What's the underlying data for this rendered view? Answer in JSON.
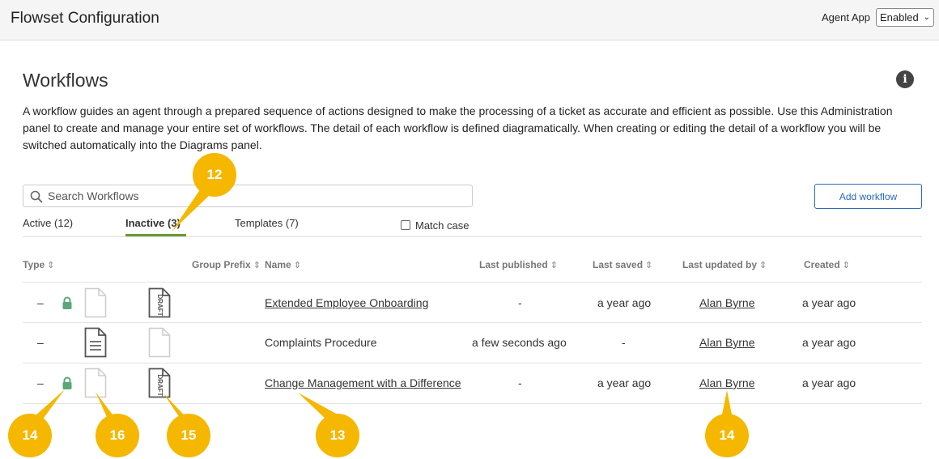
{
  "header": {
    "title": "Flowset Configuration",
    "agent_app_label": "Agent App",
    "agent_app_value": "Enabled"
  },
  "main": {
    "title": "Workflows",
    "description": "A workflow guides an agent through a prepared sequence of actions designed to make the processing of a ticket as accurate and efficient as possible. Use this Administration panel to create and manage your entire set of workflows. The detail of each workflow is defined diagramatically. When creating or editing the detail of a workflow you will be switched automatically into the Diagrams panel.",
    "search_placeholder": "Search Workflows",
    "add_button": "Add workflow",
    "tabs": [
      {
        "label": "Active (12)"
      },
      {
        "label": "Inactive (3)"
      },
      {
        "label": "Templates (7)"
      }
    ],
    "match_case_label": "Match case"
  },
  "table": {
    "columns": [
      "Type",
      "Group Prefix",
      "Name",
      "Last published",
      "Last saved",
      "Last updated by",
      "Created"
    ],
    "rows": [
      {
        "type": "–",
        "name": "Extended Employee Onboarding",
        "last_published": "-",
        "last_saved": "a year ago",
        "updated_by": "Alan Byrne",
        "created": "a year ago"
      },
      {
        "type": "–",
        "name": "Complaints Procedure",
        "last_published": "a few seconds ago",
        "last_saved": "-",
        "updated_by": "Alan Byrne",
        "created": "a year ago"
      },
      {
        "type": "–",
        "name": "Change Management with a Difference",
        "last_published": "-",
        "last_saved": "a year ago",
        "updated_by": "Alan Byrne",
        "created": "a year ago"
      }
    ],
    "draft_label": "DRAFT"
  },
  "callouts": [
    "12",
    "13",
    "14",
    "15",
    "16",
    "14"
  ],
  "colors": {
    "accent": "#2a6bb8",
    "tab_underline": "#6b9a2f",
    "lock": "#5aa77a",
    "callout": "#f5b700"
  }
}
